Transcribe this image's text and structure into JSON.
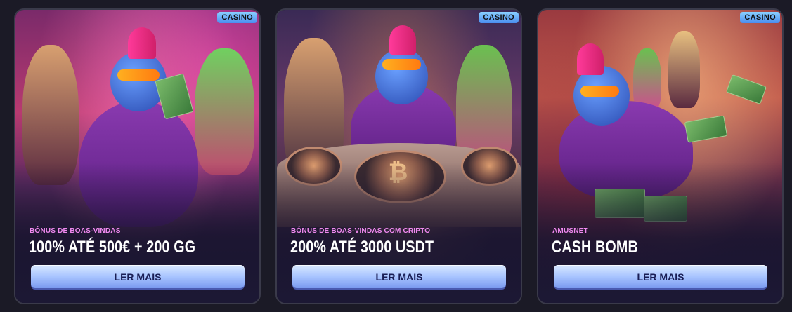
{
  "cards": [
    {
      "badge": "CASINO",
      "subtitle": "BÓNUS DE BOAS-VINDAS",
      "title": "100% ATÉ 500€ + 200 GG",
      "button": "LER MAIS"
    },
    {
      "badge": "CASINO",
      "subtitle": "BÓNUS DE BOAS-VINDAS COM CRIPTO",
      "title": "200% ATÉ 3000 USDT",
      "button": "LER MAIS"
    },
    {
      "badge": "CASINO",
      "subtitle": "AMUSNET",
      "title": "CASH BOMB",
      "button": "LER MAIS"
    }
  ],
  "colors": {
    "badge": "#4a8ef0",
    "subtitle": "#f08af0",
    "button_top": "#d8e8ff",
    "button_bottom": "#7a9af0",
    "button_text": "#1a1e55"
  }
}
